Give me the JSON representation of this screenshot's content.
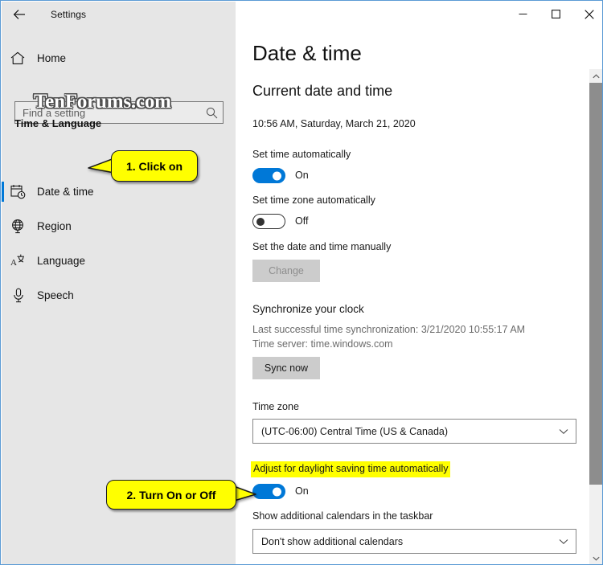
{
  "window": {
    "app_title": "Settings",
    "back_icon": "back-arrow-icon",
    "controls": {
      "minimize": "minimize-icon",
      "maximize": "maximize-icon",
      "close": "close-icon"
    }
  },
  "sidebar": {
    "home": {
      "label": "Home",
      "icon": "home-icon"
    },
    "search": {
      "placeholder": "Find a setting",
      "value": "",
      "icon": "search-icon"
    },
    "watermark": "TenForums.com",
    "group_header": "Time & Language",
    "items": [
      {
        "label": "Date & time",
        "icon": "calendar-clock-icon",
        "selected": true
      },
      {
        "label": "Region",
        "icon": "globe-icon",
        "selected": false
      },
      {
        "label": "Language",
        "icon": "language-icon",
        "selected": false
      },
      {
        "label": "Speech",
        "icon": "microphone-icon",
        "selected": false
      }
    ]
  },
  "main": {
    "page_title": "Date & time",
    "current_section": {
      "heading": "Current date and time",
      "datetime": "10:56 AM, Saturday, March 21, 2020"
    },
    "set_time_automatically": {
      "label": "Set time automatically",
      "state": "On"
    },
    "set_timezone_automatically": {
      "label": "Set time zone automatically",
      "state": "Off"
    },
    "set_manually": {
      "label": "Set the date and time manually",
      "button": "Change",
      "button_disabled": true
    },
    "synchronize": {
      "heading": "Synchronize your clock",
      "last_sync": "Last successful time synchronization: 3/21/2020 10:55:17 AM",
      "time_server": "Time server: time.windows.com",
      "button": "Sync now"
    },
    "time_zone": {
      "label": "Time zone",
      "value": "(UTC-06:00) Central Time (US & Canada)"
    },
    "daylight_saving": {
      "label": "Adjust for daylight saving time automatically",
      "state": "On",
      "highlighted": true
    },
    "additional_calendars": {
      "label": "Show additional calendars in the taskbar",
      "value": "Don't show additional calendars"
    }
  },
  "annotations": [
    {
      "text": "1. Click on"
    },
    {
      "text": "2. Turn On or Off"
    }
  ],
  "colors": {
    "accent": "#0078d7",
    "highlight": "#ffff00",
    "sidebar_bg": "#e6e6e6",
    "window_border": "#5b9bd5"
  }
}
